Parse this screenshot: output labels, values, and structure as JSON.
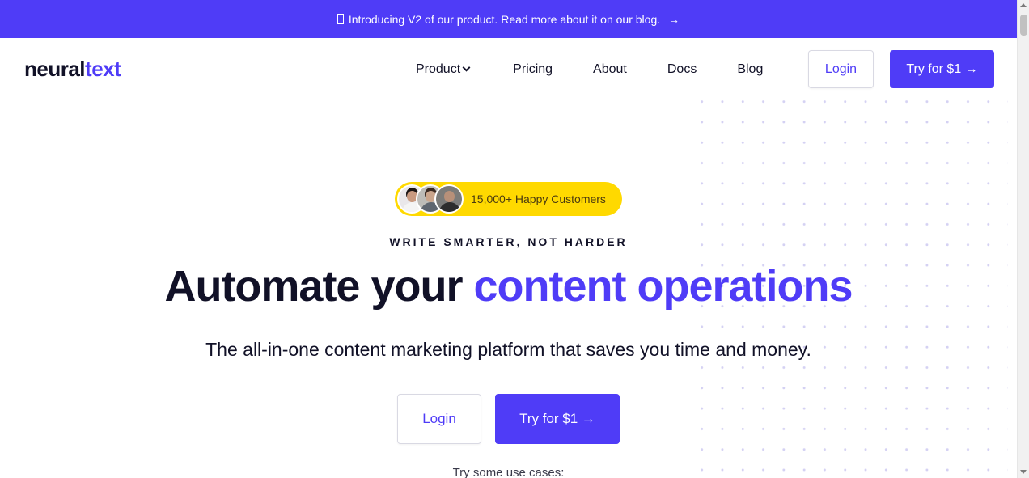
{
  "announcement": {
    "text": "Introducing V2 of our product. Read more about it on our blog.",
    "arrow": "→"
  },
  "logo": {
    "part1": "neural",
    "part2": "text"
  },
  "nav": {
    "items": [
      {
        "label": "Product"
      },
      {
        "label": "Pricing"
      },
      {
        "label": "About"
      },
      {
        "label": "Docs"
      },
      {
        "label": "Blog"
      }
    ],
    "login_label": "Login",
    "try_label": "Try for $1 →"
  },
  "hero": {
    "badge_text": "15,000+ Happy Customers",
    "eyebrow": "WRITE SMARTER, NOT HARDER",
    "headline_part1": "Automate your",
    "headline_part2": "content operations",
    "subheadline": "The all-in-one content marketing platform that saves you time and money.",
    "login_label": "Login",
    "try_label": "Try for $1 →",
    "use_cases_label": "Try some use cases:"
  },
  "colors": {
    "brand": "#4f3cf7",
    "dark": "#111127",
    "badge": "#ffd900"
  },
  "icons": [
    "chevron-down-icon",
    "arrow-right-icon",
    "dot-pattern"
  ]
}
